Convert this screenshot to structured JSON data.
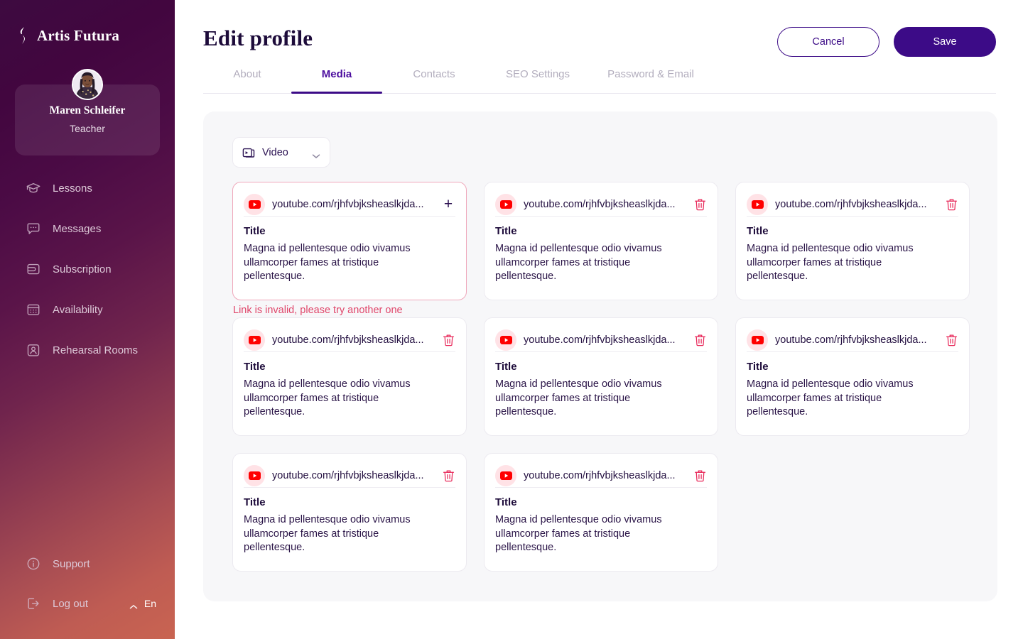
{
  "sidebar": {
    "brand": {
      "name": "Artis Futura",
      "logo_icon": "artis-futura-mark-icon"
    },
    "user": {
      "name": "Maren Schleifer",
      "role": "Teacher",
      "avatar_icon": "user-avatar"
    },
    "nav_items": [
      {
        "label": "Lessons",
        "icon": "graduation-cap-icon"
      },
      {
        "label": "Messages",
        "icon": "chat-bubble-icon"
      },
      {
        "label": "Subscription",
        "icon": "wallet-icon"
      },
      {
        "label": "Availability",
        "icon": "calendar-icon"
      },
      {
        "label": "Rehearsal Rooms",
        "icon": "user-square-icon"
      }
    ],
    "bottom_items": [
      {
        "label": "Support",
        "icon": "info-circle-icon"
      },
      {
        "label": "Log out",
        "icon": "logout-icon"
      }
    ],
    "language": {
      "label": "En",
      "icon": "chevron-up-icon"
    }
  },
  "header": {
    "title": "Edit profile",
    "cancel_label": "Cancel",
    "save_label": "Save"
  },
  "tabs": [
    {
      "label": "About",
      "active": false
    },
    {
      "label": "Media",
      "active": true
    },
    {
      "label": "Contacts",
      "active": false
    },
    {
      "label": "SEO Settings",
      "active": false
    },
    {
      "label": "Password & Email",
      "active": false
    }
  ],
  "filter": {
    "selected": "Video",
    "icon": "video-icon",
    "chevron": "chevron-down-icon"
  },
  "media": {
    "url": "youtube.com/rjhfvbjksheaslkjda...",
    "title": "Title",
    "description": "Magna id pellentesque odio vivamus ullamcorper fames at tristique pellentesque.",
    "error_message": "Link is invalid, please try another one",
    "source_icon": "youtube-icon",
    "delete_icon": "trash-icon",
    "add_icon": "plus-icon",
    "cards": [
      {
        "invalid": true,
        "action": "add"
      },
      {
        "invalid": false,
        "action": "delete"
      },
      {
        "invalid": false,
        "action": "delete"
      },
      {
        "invalid": false,
        "action": "delete"
      },
      {
        "invalid": false,
        "action": "delete"
      },
      {
        "invalid": false,
        "action": "delete"
      },
      {
        "invalid": false,
        "action": "delete"
      },
      {
        "invalid": false,
        "action": "delete"
      }
    ]
  },
  "colors": {
    "brand_purple": "#3c0b87",
    "active_tab": "#4b0d9e",
    "error": "#e0476b",
    "youtube_red": "#ff0000",
    "panel_bg": "#f7f7f9"
  }
}
